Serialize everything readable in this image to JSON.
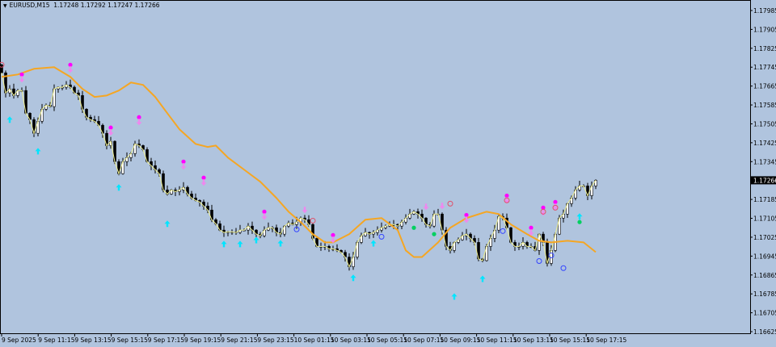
{
  "header": {
    "symbol": "EURUSD,M15",
    "open": "1.17248",
    "high": "1.17292",
    "low": "1.17247",
    "close": "1.17266"
  },
  "colors": {
    "background": "#b0c4de",
    "bull": "#ffffff",
    "bear": "#000000",
    "ma": "#f5a623",
    "close_line": "#f0f090",
    "buy_arrow": "#00e5ff",
    "sell_dot": "#ff00ff",
    "sell_arrow": "#ee88ee",
    "blue_circle": "#3344ff",
    "red_circle": "#e0506a",
    "green_dot": "#00d060"
  },
  "chart_data": {
    "type": "candlestick",
    "title": "EURUSD,M15",
    "ylim": [
      1.16625,
      1.17985
    ],
    "yticks": [
      "1.17985",
      "1.17905",
      "1.17825",
      "1.17745",
      "1.17665",
      "1.17585",
      "1.17505",
      "1.17425",
      "1.17345",
      "1.17265",
      "1.17185",
      "1.17105",
      "1.17025",
      "1.16945",
      "1.16865",
      "1.16785",
      "1.16705",
      "1.16625"
    ],
    "current_price": "1.17266",
    "xticks": [
      "9 Sep 2025",
      "9 Sep 11:15",
      "9 Sep 13:15",
      "9 Sep 15:15",
      "9 Sep 17:15",
      "9 Sep 19:15",
      "9 Sep 21:15",
      "9 Sep 23:15",
      "10 Sep 01:15",
      "10 Sep 03:15",
      "10 Sep 05:15",
      "10 Sep 07:15",
      "10 Sep 09:15",
      "10 Sep 11:15",
      "10 Sep 13:15",
      "10 Sep 15:15",
      "10 Sep 17:15"
    ],
    "first_open": 1.17755,
    "closes": [
      1.17721,
      1.17636,
      1.17653,
      1.17625,
      1.17646,
      1.17646,
      1.1755,
      1.17523,
      1.17465,
      1.17516,
      1.17567,
      1.17584,
      1.17578,
      1.17653,
      1.1766,
      1.1766,
      1.1767,
      1.1766,
      1.17636,
      1.17625,
      1.17567,
      1.17533,
      1.17523,
      1.17516,
      1.17499,
      1.17465,
      1.17413,
      1.17431,
      1.17345,
      1.17294,
      1.17345,
      1.17362,
      1.17379,
      1.1742,
      1.17413,
      1.17396,
      1.17345,
      1.17328,
      1.17311,
      1.17294,
      1.17225,
      1.17208,
      1.17225,
      1.17218,
      1.17225,
      1.17236,
      1.17208,
      1.17191,
      1.17181,
      1.17174,
      1.17157,
      1.1714,
      1.17099,
      1.17082,
      1.17055,
      1.17045,
      1.17048,
      1.17048,
      1.17045,
      1.17055,
      1.17055,
      1.17072,
      1.17055,
      1.17038,
      1.17031,
      1.17055,
      1.17065,
      1.17065,
      1.17045,
      1.17038,
      1.17072,
      1.17085,
      1.17079,
      1.17089,
      1.17106,
      1.17099,
      1.17079,
      1.1702,
      1.16986,
      1.16986,
      1.16986,
      1.16976,
      1.16976,
      1.16969,
      1.16961,
      1.16941,
      1.169,
      1.16941,
      1.17003,
      1.17031,
      1.17045,
      1.17038,
      1.17045,
      1.17055,
      1.17065,
      1.17072,
      1.17079,
      1.17079,
      1.17072,
      1.17089,
      1.17106,
      1.17123,
      1.17133,
      1.17123,
      1.17106,
      1.17079,
      1.17072,
      1.17123,
      1.17123,
      1.17055,
      1.16986,
      1.16969,
      1.17003,
      1.17014,
      1.17031,
      1.17038,
      1.1702,
      1.17003,
      1.16933,
      1.16926,
      1.16986,
      1.1702,
      1.17055,
      1.17113,
      1.17106,
      1.17065,
      1.17003,
      1.16986,
      1.16986,
      1.17003,
      1.16986,
      1.16986,
      1.16969,
      1.17038,
      1.17003,
      1.16914,
      1.16969,
      1.17038,
      1.17106,
      1.17123,
      1.17167,
      1.17191,
      1.17225,
      1.17242,
      1.17242,
      1.17201,
      1.17242,
      1.17266
    ],
    "ma": [
      [
        0,
        1.17704
      ],
      [
        4,
        1.17714
      ],
      [
        8,
        1.17738
      ],
      [
        13,
        1.17745
      ],
      [
        17,
        1.17704
      ],
      [
        20,
        1.17653
      ],
      [
        23,
        1.17619
      ],
      [
        26,
        1.17625
      ],
      [
        29,
        1.17646
      ],
      [
        32,
        1.1768
      ],
      [
        35,
        1.1767
      ],
      [
        38,
        1.17619
      ],
      [
        41,
        1.1755
      ],
      [
        44,
        1.17482
      ],
      [
        48,
        1.1742
      ],
      [
        51,
        1.17407
      ],
      [
        53,
        1.17413
      ],
      [
        56,
        1.17362
      ],
      [
        60,
        1.17311
      ],
      [
        64,
        1.1726
      ],
      [
        68,
        1.17191
      ],
      [
        71,
        1.17133
      ],
      [
        74,
        1.17089
      ],
      [
        77,
        1.17038
      ],
      [
        80,
        1.17003
      ],
      [
        82,
        1.17003
      ],
      [
        86,
        1.17038
      ],
      [
        90,
        1.17099
      ],
      [
        94,
        1.17106
      ],
      [
        98,
        1.17055
      ],
      [
        100,
        1.16969
      ],
      [
        102,
        1.16941
      ],
      [
        104,
        1.16941
      ],
      [
        108,
        1.17003
      ],
      [
        111,
        1.17065
      ],
      [
        115,
        1.17106
      ],
      [
        120,
        1.17133
      ],
      [
        123,
        1.17123
      ],
      [
        126,
        1.17079
      ],
      [
        130,
        1.17038
      ],
      [
        133,
        1.1701
      ],
      [
        136,
        1.17003
      ],
      [
        140,
        1.1701
      ],
      [
        144,
        1.17003
      ],
      [
        147,
        1.16962
      ]
    ],
    "markers": {
      "buy_arrows": [
        [
          2,
          1.17523
        ],
        [
          9,
          1.17389
        ],
        [
          29,
          1.17236
        ],
        [
          41,
          1.17082
        ],
        [
          55,
          1.16996
        ],
        [
          59,
          1.16996
        ],
        [
          63,
          1.17013
        ],
        [
          69,
          1.16999
        ],
        [
          87,
          1.16853
        ],
        [
          92,
          1.16999
        ],
        [
          112,
          1.16774
        ],
        [
          119,
          1.16849
        ],
        [
          143,
          1.17113
        ]
      ],
      "sell_signals": [
        [
          5,
          1.17714
        ],
        [
          17,
          1.17755
        ],
        [
          27,
          1.17489
        ],
        [
          34,
          1.17533
        ],
        [
          45,
          1.17345
        ],
        [
          50,
          1.17277
        ],
        [
          65,
          1.17133
        ],
        [
          82,
          1.17034
        ],
        [
          115,
          1.17119
        ],
        [
          125,
          1.17201
        ],
        [
          131,
          1.17065
        ],
        [
          134,
          1.1715
        ],
        [
          137,
          1.17174
        ]
      ],
      "sell_arrows": [
        [
          75,
          1.1714
        ],
        [
          105,
          1.17154
        ],
        [
          109,
          1.17157
        ]
      ],
      "red_circles": [
        [
          0,
          1.17755
        ],
        [
          77,
          1.17095
        ],
        [
          111,
          1.17167
        ],
        [
          125,
          1.17181
        ],
        [
          134,
          1.17133
        ],
        [
          137,
          1.1715
        ]
      ],
      "blue_circles": [
        [
          73,
          1.17058
        ],
        [
          94,
          1.17027
        ],
        [
          124,
          1.17051
        ],
        [
          133,
          1.16924
        ],
        [
          136,
          1.16948
        ],
        [
          139,
          1.16894
        ]
      ],
      "green_dots": [
        [
          102,
          1.17065
        ],
        [
          107,
          1.17038
        ],
        [
          143,
          1.17089
        ]
      ]
    }
  }
}
